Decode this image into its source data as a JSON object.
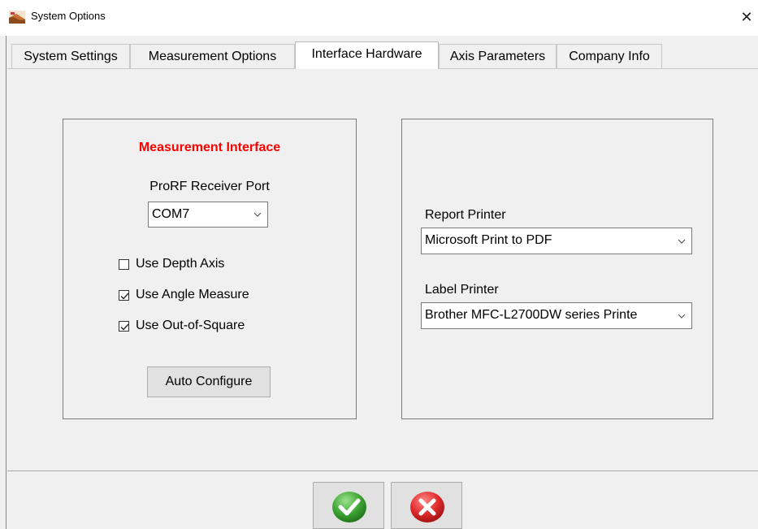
{
  "window": {
    "title": "System Options",
    "close_glyph": "✕"
  },
  "tabs": [
    {
      "label": "System Settings",
      "active": false
    },
    {
      "label": "Measurement Options",
      "active": false
    },
    {
      "label": "Interface Hardware",
      "active": true
    },
    {
      "label": "Axis Parameters",
      "active": false
    },
    {
      "label": "Company Info",
      "active": false
    }
  ],
  "measurement_interface": {
    "heading": "Measurement Interface",
    "heading_color": "#ff0000",
    "port_label": "ProRF Receiver Port",
    "port_value": "COM7",
    "options": [
      {
        "label": "Use Depth Axis",
        "checked": false
      },
      {
        "label": "Use Angle Measure",
        "checked": true
      },
      {
        "label": "Use Out-of-Square",
        "checked": true
      }
    ],
    "auto_configure_label": "Auto Configure"
  },
  "printers": {
    "report_label": "Report Printer",
    "report_value": "Microsoft Print to PDF",
    "label_label": "Label Printer",
    "label_value": "Brother MFC-L2700DW series Printe"
  },
  "footer": {
    "ok_icon": "green-check-icon",
    "cancel_icon": "red-x-icon",
    "ok_color": "#3fa535",
    "cancel_color": "#e02b2b"
  }
}
